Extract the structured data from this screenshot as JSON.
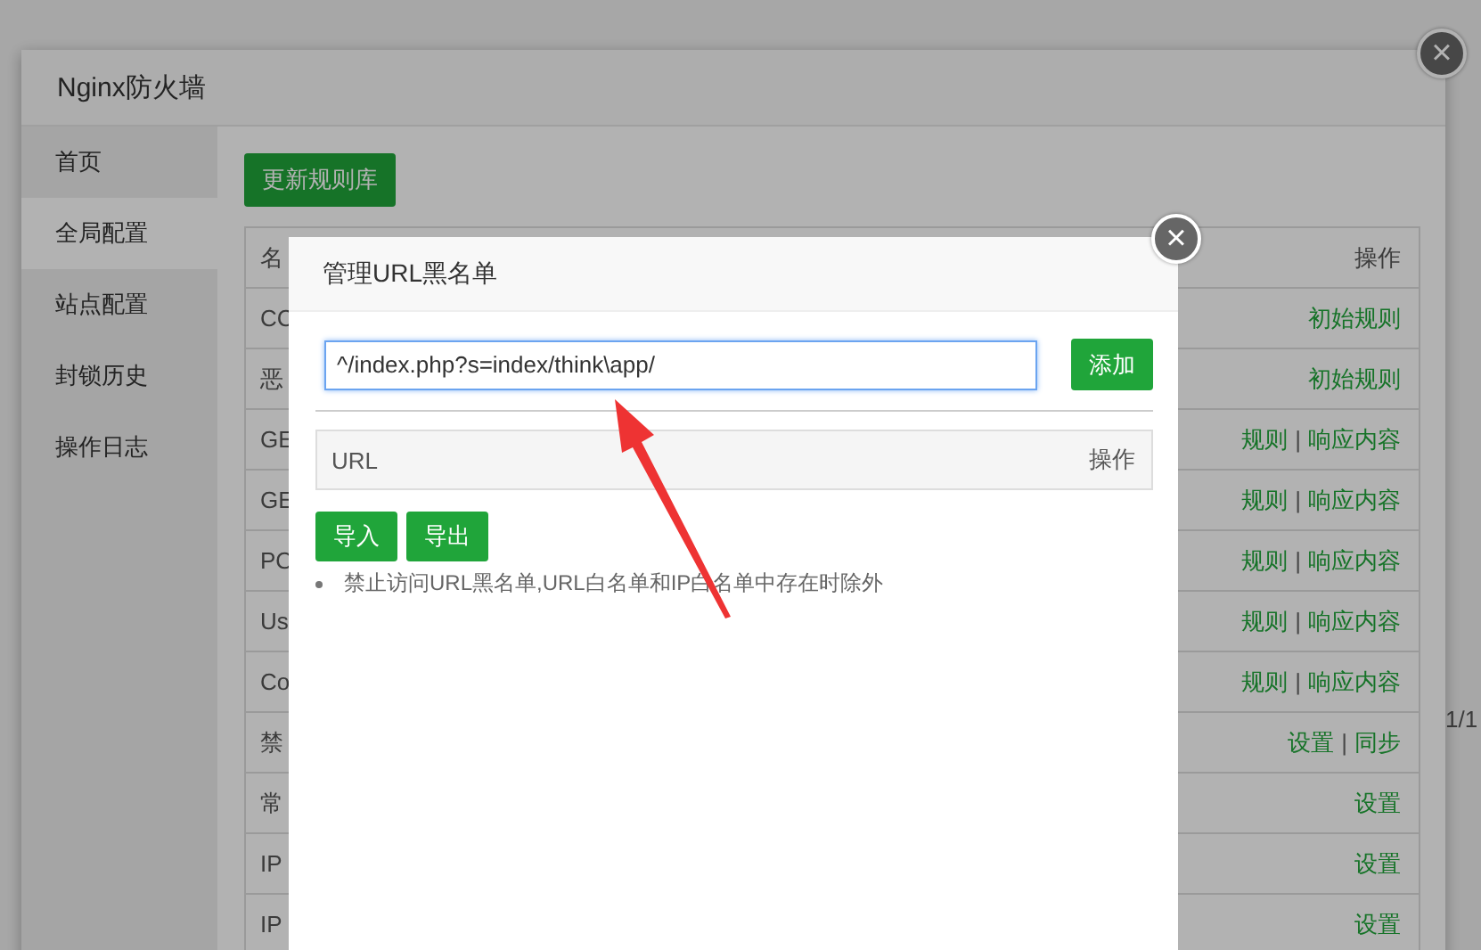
{
  "background_page": {
    "pager": "1/1"
  },
  "firewall_window": {
    "title": "Nginx防火墙",
    "close": "×",
    "sidebar": {
      "items": [
        {
          "label": "首页",
          "selected": false
        },
        {
          "label": "全局配置",
          "selected": true
        },
        {
          "label": "站点配置",
          "selected": false
        },
        {
          "label": "封锁历史",
          "selected": false
        },
        {
          "label": "操作日志",
          "selected": false
        }
      ]
    },
    "update_button": "更新规则库",
    "table": {
      "columns": [
        "名",
        "操作"
      ],
      "rows": [
        {
          "name": "CC",
          "actions": [
            {
              "kind": "link",
              "text": "初始规则"
            }
          ]
        },
        {
          "name": "恶",
          "actions": [
            {
              "kind": "link",
              "text": "初始规则"
            }
          ]
        },
        {
          "name": "GE",
          "actions": [
            {
              "kind": "link",
              "text": "规则"
            },
            {
              "kind": "separator",
              "text": "|"
            },
            {
              "kind": "link",
              "text": "响应内容"
            }
          ]
        },
        {
          "name": "GE",
          "actions": [
            {
              "kind": "link",
              "text": "规则"
            },
            {
              "kind": "separator",
              "text": "|"
            },
            {
              "kind": "link",
              "text": "响应内容"
            }
          ]
        },
        {
          "name": "PO",
          "actions": [
            {
              "kind": "link",
              "text": "规则"
            },
            {
              "kind": "separator",
              "text": "|"
            },
            {
              "kind": "link",
              "text": "响应内容"
            }
          ]
        },
        {
          "name": "Us",
          "actions": [
            {
              "kind": "link",
              "text": "规则"
            },
            {
              "kind": "separator",
              "text": "|"
            },
            {
              "kind": "link",
              "text": "响应内容"
            }
          ]
        },
        {
          "name": "Co",
          "actions": [
            {
              "kind": "link",
              "text": "规则"
            },
            {
              "kind": "separator",
              "text": "|"
            },
            {
              "kind": "link",
              "text": "响应内容"
            }
          ]
        },
        {
          "name": "禁",
          "actions": [
            {
              "kind": "link",
              "text": "设置"
            },
            {
              "kind": "separator",
              "text": "|"
            },
            {
              "kind": "link",
              "text": "同步"
            }
          ]
        },
        {
          "name": "常",
          "actions": [
            {
              "kind": "link",
              "text": "设置"
            }
          ]
        },
        {
          "name": "IP",
          "actions": [
            {
              "kind": "link",
              "text": "设置"
            }
          ]
        },
        {
          "name": "IP",
          "actions": [
            {
              "kind": "link",
              "text": "设置"
            }
          ]
        }
      ]
    }
  },
  "dialog": {
    "title": "管理URL黑名单",
    "close": "×",
    "url_input": {
      "value": "^/index.php?s=index/think\\app/"
    },
    "add_button": "添加",
    "table": {
      "columns": [
        "URL",
        "操作"
      ]
    },
    "import_button": "导入",
    "export_button": "导出",
    "note": "禁止访问URL黑名单,URL白名单和IP白名单中存在时除外"
  }
}
